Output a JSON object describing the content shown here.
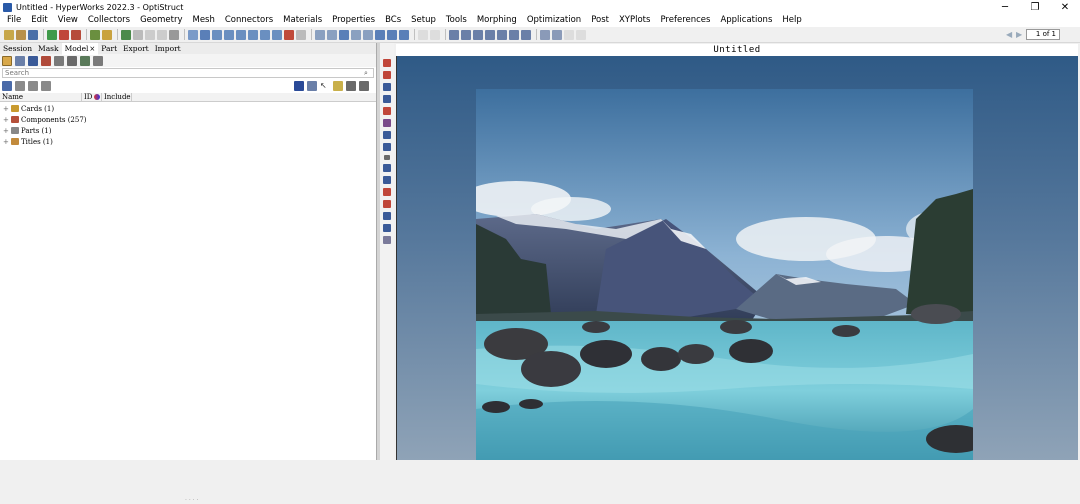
{
  "window": {
    "title": "Untitled - HyperWorks 2022.3 - OptiStruct",
    "minimize": "─",
    "maximize": "❐",
    "close": "✕"
  },
  "menu": [
    "File",
    "Edit",
    "View",
    "Collectors",
    "Geometry",
    "Mesh",
    "Connectors",
    "Materials",
    "Properties",
    "BCs",
    "Setup",
    "Tools",
    "Morphing",
    "Optimization",
    "Post",
    "XYPlots",
    "Preferences",
    "Applications",
    "Help"
  ],
  "page": {
    "value": "1 of 1"
  },
  "browser": {
    "tabs": [
      {
        "label": "Session",
        "closable": false
      },
      {
        "label": "Mask",
        "closable": false
      },
      {
        "label": "Model",
        "closable": true
      },
      {
        "label": "Part",
        "closable": false
      },
      {
        "label": "Export",
        "closable": false
      },
      {
        "label": "Import",
        "closable": false
      }
    ],
    "search_placeholder": "Search",
    "columns": {
      "name": "Name",
      "id": "ID",
      "include": "Include"
    },
    "tree": [
      {
        "label": "Cards (1)",
        "color": "#c99a2e"
      },
      {
        "label": "Components (257)",
        "color": "#b5503a"
      },
      {
        "label": "Parts (1)",
        "color": "#888888"
      },
      {
        "label": "Titles (1)",
        "color": "#c28a3c"
      }
    ]
  },
  "viewport": {
    "title": "Untitled",
    "background_top": "#2f5a86",
    "background_bottom": "#8fa3b7"
  }
}
